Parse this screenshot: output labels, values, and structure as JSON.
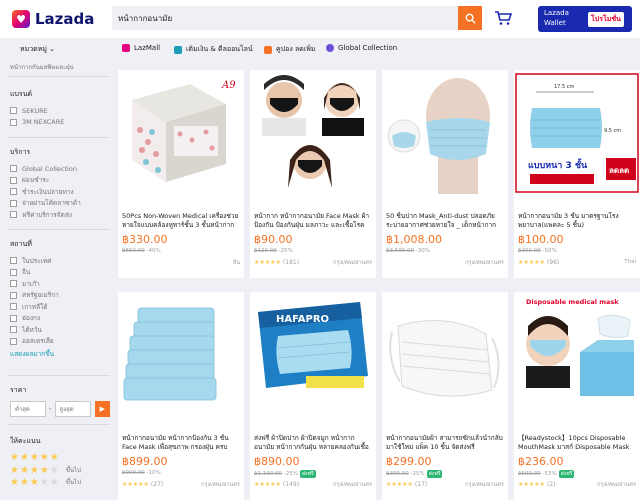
{
  "header": {
    "logo": "Lazada",
    "search_value": "หน้ากากอนามัย",
    "wallet_line1": "Lazada",
    "wallet_line2": "Wallet",
    "wallet_button": "โปรโมชั่น"
  },
  "subbar": {
    "categories": "หมวดหมู่",
    "links": [
      {
        "label": "LazMall",
        "color": "#e4007f"
      },
      {
        "label": "เติมเงิน & ดีลออนไลน์",
        "color": "#1a9cb7"
      },
      {
        "label": "คูปอง ลดเพิ่ม",
        "color": "#f57224"
      },
      {
        "label": "Global Collection",
        "color": "#6b4fd8"
      }
    ]
  },
  "sidebar": {
    "breadcrumb": "หน้ากากกันมลพิษและฝุ่น",
    "brand": {
      "title": "แบรนด์",
      "items": [
        "SEKURE",
        "3M NEXCARE"
      ]
    },
    "service": {
      "title": "บริการ",
      "items": [
        "Global Collection",
        "ผ่อนชำระ",
        "ชำระเงินปลายทาง",
        "จ่ายผ่านโค้ดลาซาด้า",
        "ฟรีค่าบริการจัดส่ง"
      ]
    },
    "location": {
      "title": "สถานที่",
      "items": [
        "ในประเทศ",
        "จีน",
        "มาเก๊า",
        "สหรัฐอเมริกา",
        "เกาหลีใต้",
        "ฮ่องกง",
        "ไต้หวัน",
        "ออสเตรเลีย"
      ],
      "more": "แสดงผลมากขึ้น"
    },
    "price": {
      "title": "ราคา",
      "min_placeholder": "ต่ำสุด",
      "max_placeholder": "สูงสุด"
    },
    "rating": {
      "title": "ให้คะแนน",
      "and_up": "ขึ้นไป"
    }
  },
  "products": [
    {
      "title": "50Pcs Non-Woven Medical เครื่องช่วยหายใจแบบคล้องหูทาร์ชั้น 3 ชั้นหน้ากาก",
      "price": "฿330.00",
      "orig": "฿550.00",
      "disc": "-40%",
      "reviews": "",
      "loc": "จีน",
      "badge": ""
    },
    {
      "title": "หน้ากาก หน้ากากอนามัย Face Mask ผ้า ป้องกัน ป้องกันฝุ่น มลภาวะ และเชื้อโรค",
      "price": "฿90.00",
      "orig": "฿120.00",
      "disc": "-25%",
      "reviews": "(181)",
      "loc": "กรุงเทพมหานคร",
      "badge": ""
    },
    {
      "title": "50 ชิ้นปาก Mask_Anti-dust ปลอดภัยระบายอากาศช่วยหายใจ _ เด็กหน้ากาก",
      "price": "฿1,008.00",
      "orig": "฿3,500.00",
      "disc": "-30%",
      "reviews": "",
      "loc": "กรุงเทพมหานคร",
      "badge": ""
    },
    {
      "title": "หน้ากากอนามัย 3 ชั้น มาตรฐานโรงพยาบาล(แพคละ 5 ชิ้น)",
      "price": "฿100.00",
      "orig": "฿200.00",
      "disc": "-50%",
      "reviews": "(96)",
      "loc": "Thai",
      "badge": ""
    },
    {
      "title": "หน้ากากอนามัย หน้ากากป้องกัน 3 ชั้น Face Mask เพื่อสุขภาพ กรองฝุ่น ครบ",
      "price": "฿899.00",
      "orig": "฿999.00",
      "disc": "-10%",
      "reviews": "(27)",
      "loc": "กรุงเทพมหานคร",
      "badge": ""
    },
    {
      "title": "ส่งฟรี ผ้าปิดปาก ผ้าปิดจมูก หน้ากากอนามัย หน้ากากกันฝุ่น หลายคลองกันเชื้อ",
      "price": "฿890.00",
      "orig": "฿1,190.00",
      "disc": "-25%",
      "reviews": "(149)",
      "loc": "กรุงเทพมหานคร",
      "badge": "ส่งฟรี"
    },
    {
      "title": "หน้ากากอนามัยผ้า สามารถซักแล้วนำกลับมาใช้ใหม่ แพ็ค 10 ชิ้น จัดส่งฟรี",
      "price": "฿299.00",
      "orig": "฿399.00",
      "disc": "-25%",
      "reviews": "(17)",
      "loc": "กรุงเทพมหานคร",
      "badge": "ส่งฟรี"
    },
    {
      "title": "【Readystock】10pcs Disposable MouthMask มาสก์ Disposable Mask",
      "price": "฿236.00",
      "orig": "฿500.00",
      "disc": "-53%",
      "reviews": "(2)",
      "loc": "กรุงเทพมหานคร",
      "badge": "ส่งฟรี"
    }
  ],
  "image_overlays": {
    "a9": "A9",
    "size_top": "17.5 cm",
    "size_side": "9.5 cm",
    "layers": "แบบหนา 3 ชั้น",
    "sale": "ลดลด",
    "hafapro": "HAFAPRO",
    "disposable": "Disposable medical mask"
  }
}
